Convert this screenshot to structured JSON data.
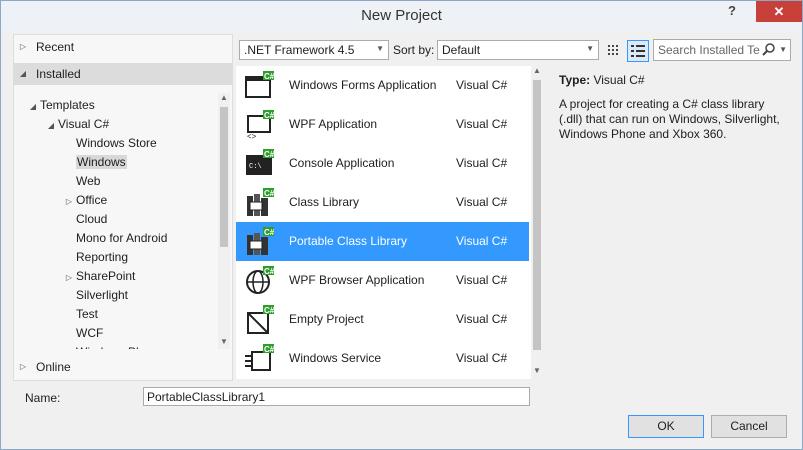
{
  "window": {
    "title": "New Project",
    "help_label": "?",
    "close_label": "✕"
  },
  "left_panel": {
    "recent": "Recent",
    "installed": "Installed",
    "online": "Online",
    "tree": [
      {
        "label": "Templates",
        "level": 0,
        "expander": "◢"
      },
      {
        "label": "Visual C#",
        "level": 1,
        "expander": "◢"
      },
      {
        "label": "Windows Store",
        "level": 2,
        "expander": ""
      },
      {
        "label": "Windows",
        "level": 2,
        "expander": "",
        "selected": true
      },
      {
        "label": "Web",
        "level": 2,
        "expander": ""
      },
      {
        "label": "Office",
        "level": 2,
        "expander": "▷"
      },
      {
        "label": "Cloud",
        "level": 2,
        "expander": ""
      },
      {
        "label": "Mono for Android",
        "level": 2,
        "expander": ""
      },
      {
        "label": "Reporting",
        "level": 2,
        "expander": ""
      },
      {
        "label": "SharePoint",
        "level": 2,
        "expander": "▷"
      },
      {
        "label": "Silverlight",
        "level": 2,
        "expander": ""
      },
      {
        "label": "Test",
        "level": 2,
        "expander": ""
      },
      {
        "label": "WCF",
        "level": 2,
        "expander": ""
      },
      {
        "label": "Windows Phone",
        "level": 2,
        "expander": ""
      }
    ]
  },
  "toolbar": {
    "framework": ".NET Framework 4.5",
    "sort_label": "Sort by:",
    "sort_value": "Default",
    "search_placeholder": "Search Installed Te"
  },
  "templates": [
    {
      "name": "Windows Forms Application",
      "lang": "Visual C#",
      "icon": "winforms-icon"
    },
    {
      "name": "WPF Application",
      "lang": "Visual C#",
      "icon": "wpf-icon"
    },
    {
      "name": "Console Application",
      "lang": "Visual C#",
      "icon": "console-icon"
    },
    {
      "name": "Class Library",
      "lang": "Visual C#",
      "icon": "class-library-icon"
    },
    {
      "name": "Portable Class Library",
      "lang": "Visual C#",
      "icon": "portable-class-library-icon",
      "selected": true
    },
    {
      "name": "WPF Browser Application",
      "lang": "Visual C#",
      "icon": "wpf-browser-icon"
    },
    {
      "name": "Empty Project",
      "lang": "Visual C#",
      "icon": "empty-project-icon"
    },
    {
      "name": "Windows Service",
      "lang": "Visual C#",
      "icon": "windows-service-icon"
    }
  ],
  "description": {
    "type_label": "Type:",
    "type_value": "Visual C#",
    "text": "A project for creating a C# class library (.dll) that can run on Windows, Silverlight, Windows Phone and Xbox 360."
  },
  "bottom": {
    "name_label": "Name:",
    "name_value": "PortableClassLibrary1",
    "ok_label": "OK",
    "cancel_label": "Cancel"
  },
  "colors": {
    "selection": "#3399ff",
    "close": "#c7403a",
    "badge": "#2e9e2e"
  }
}
